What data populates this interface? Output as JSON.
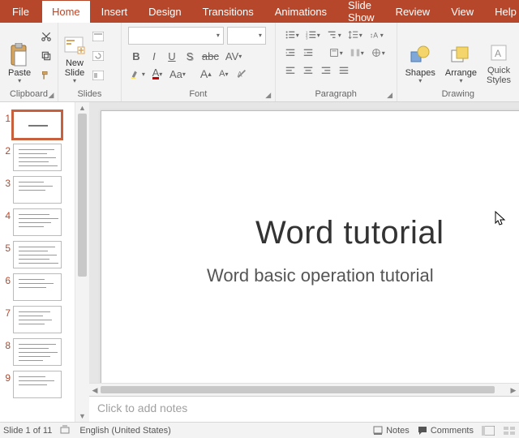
{
  "tabs": [
    "File",
    "Home",
    "Insert",
    "Design",
    "Transitions",
    "Animations",
    "Slide Show",
    "Review",
    "View",
    "Help"
  ],
  "active_tab": "Home",
  "ribbon": {
    "clipboard": {
      "paste": "Paste",
      "label": "Clipboard"
    },
    "slides": {
      "new_slide": "New\nSlide",
      "label": "Slides"
    },
    "font": {
      "label": "Font"
    },
    "paragraph": {
      "label": "Paragraph"
    },
    "drawing": {
      "shapes": "Shapes",
      "arrange": "Arrange",
      "quick": "Quick\nStyles",
      "label": "Drawing"
    }
  },
  "thumbnails": {
    "count": 9,
    "selected": 1
  },
  "slide": {
    "title": "Word tutorial",
    "subtitle": "Word basic operation tutorial"
  },
  "notes_placeholder": "Click to add notes",
  "status": {
    "slide_label": "Slide 1 of 11",
    "language": "English (United States)",
    "notes": "Notes",
    "comments": "Comments"
  }
}
